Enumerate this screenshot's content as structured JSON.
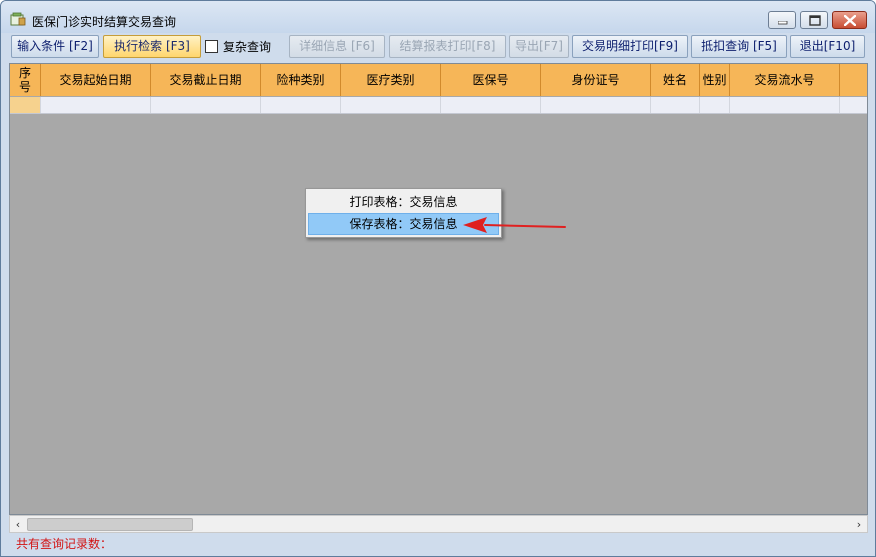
{
  "window": {
    "title": "医保门诊实时结算交易查询"
  },
  "toolbar": {
    "buttons": [
      {
        "label": "输入条件 [F2]"
      },
      {
        "label": "执行检索 [F3]"
      },
      {
        "label": "详细信息 [F6]"
      },
      {
        "label": "结算报表打印[F8]"
      },
      {
        "label": "导出[F7]"
      },
      {
        "label": "交易明细打印[F9]"
      },
      {
        "label": "抵扣查询 [F5]"
      },
      {
        "label": "退出[F10]"
      }
    ],
    "complex_query_label": "复杂查询"
  },
  "grid": {
    "columns": [
      "序\n号",
      "交易起始日期",
      "交易截止日期",
      "险种类别",
      "医疗类别",
      "医保号",
      "身份证号",
      "姓名",
      "性别",
      "交易流水号"
    ]
  },
  "context_menu": {
    "items": [
      {
        "label": "打印表格：交易信息"
      },
      {
        "label": "保存表格：交易信息"
      }
    ]
  },
  "status": {
    "record_count_label": "共有查询记录数："
  },
  "colors": {
    "header_bg": "#f6b658",
    "grid_bg": "#a8a8a8",
    "highlight": "#91c9f7",
    "arrow": "#e02020",
    "status_text": "#d21414"
  }
}
